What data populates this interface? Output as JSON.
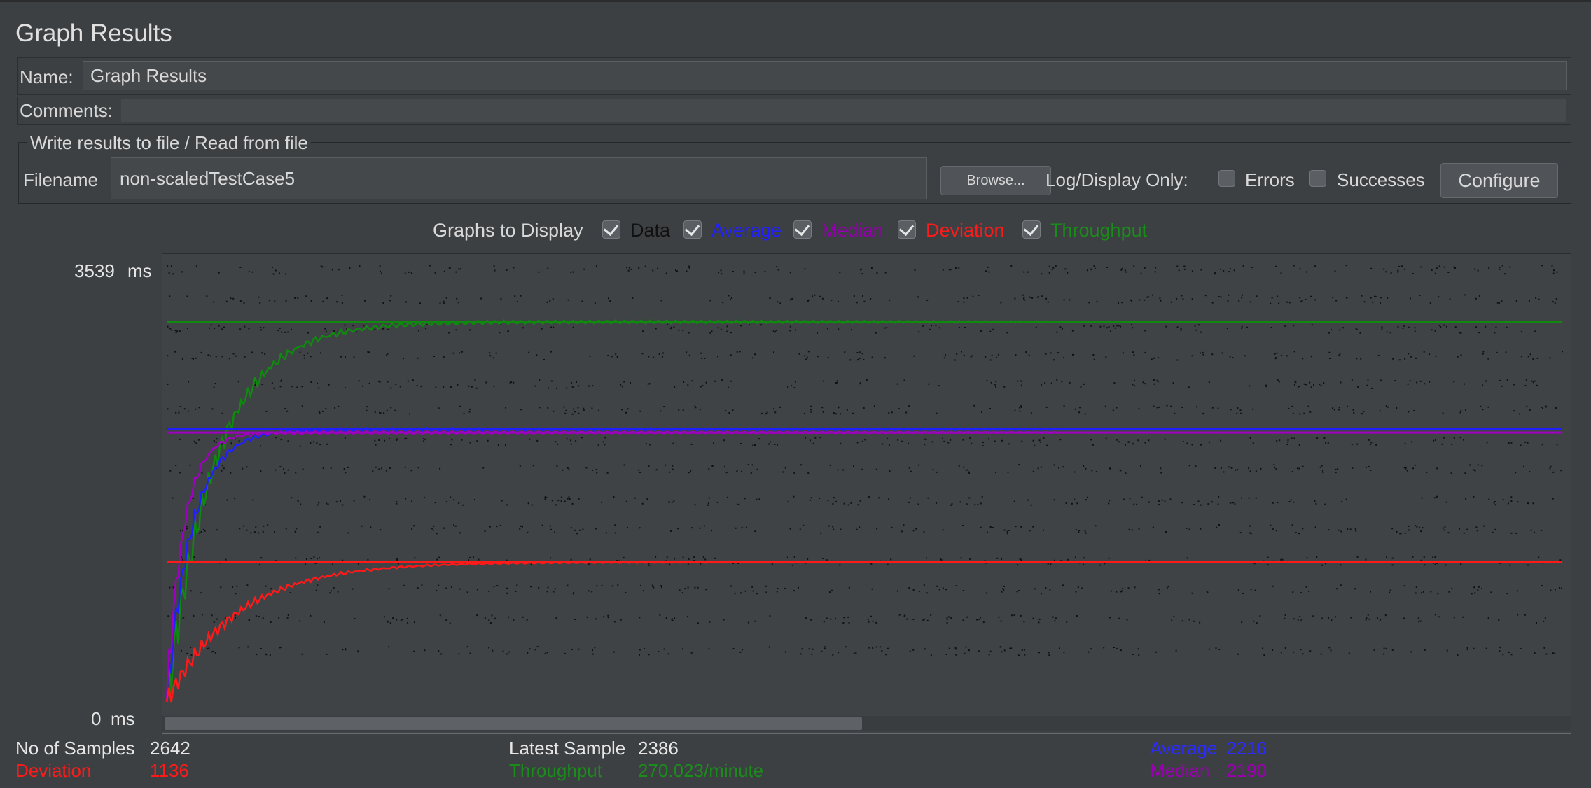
{
  "panel": {
    "title": "Graph Results"
  },
  "name_field": {
    "label": "Name:",
    "value": "Graph Results"
  },
  "comments_field": {
    "label": "Comments:",
    "value": ""
  },
  "file_group": {
    "legend": "Write results to file / Read from file",
    "filename_label": "Filename",
    "filename_value": "non-scaledTestCase5",
    "browse_label": "Browse...",
    "log_display_label": "Log/Display Only:",
    "errors_label": "Errors",
    "successes_label": "Successes",
    "configure_label": "Configure"
  },
  "graphs": {
    "label": "Graphs to Display",
    "items": [
      {
        "label": "Data",
        "color": "#111111",
        "checked": true
      },
      {
        "label": "Average",
        "color": "#1f1fff",
        "checked": true
      },
      {
        "label": "Median",
        "color": "#8f00a8",
        "checked": true
      },
      {
        "label": "Deviation",
        "color": "#ff1a1a",
        "checked": true
      },
      {
        "label": "Throughput",
        "color": "#1a8c1a",
        "checked": true
      }
    ]
  },
  "axis": {
    "max_label": "3539",
    "min_label": "0",
    "unit": "ms"
  },
  "chart_data": {
    "type": "line",
    "ylim": [
      0,
      3539
    ],
    "samples": 2642,
    "series": [
      {
        "name": "Throughput",
        "color": "#0f8a0f",
        "final": 3090
      },
      {
        "name": "Average",
        "color": "#1f1fff",
        "final": 2216
      },
      {
        "name": "Median",
        "color": "#a000c0",
        "final": 2190
      },
      {
        "name": "Deviation",
        "color": "#ff1a1a",
        "final": 1136
      }
    ]
  },
  "stats": {
    "samples_label": "No of Samples",
    "samples_value": "2642",
    "deviation_label": "Deviation",
    "deviation_value": "1136",
    "latest_label": "Latest Sample",
    "latest_value": "2386",
    "throughput_label": "Throughput",
    "throughput_value": "270.023/minute",
    "average_label": "Average",
    "average_value": "2216",
    "median_label": "Median",
    "median_value": "2190"
  }
}
